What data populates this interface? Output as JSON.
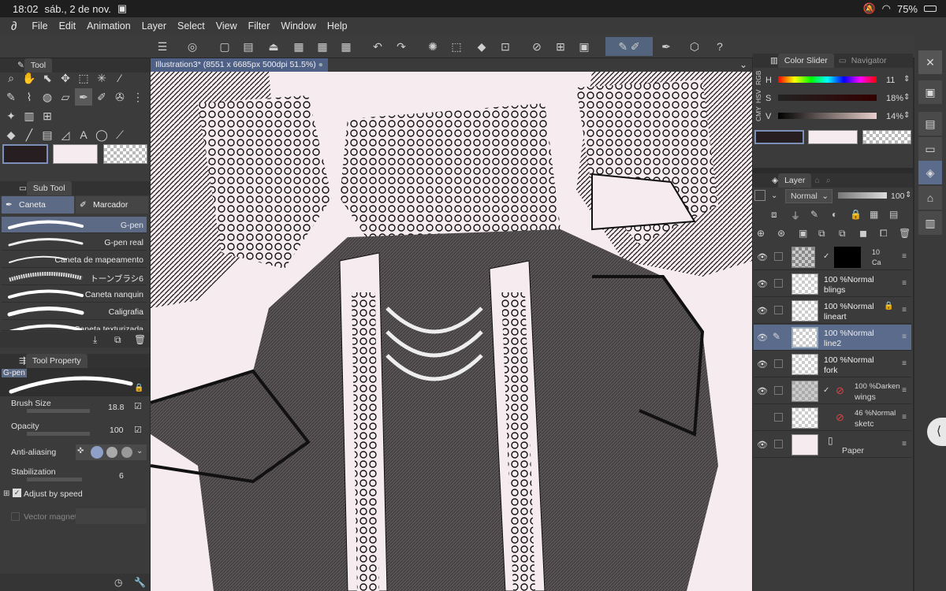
{
  "status_bar": {
    "time": "18:02",
    "date": "sáb., 2 de nov.",
    "battery": "75%"
  },
  "menu": [
    "File",
    "Edit",
    "Animation",
    "Layer",
    "Select",
    "View",
    "Filter",
    "Window",
    "Help"
  ],
  "document_tab": {
    "title": "Illustration3* (8551 x 6685px 500dpi 51.5%)"
  },
  "tool_panel": {
    "title": "Tool"
  },
  "sub_tool_panel": {
    "title": "Sub Tool",
    "tabs": [
      "Caneta",
      "Marcador"
    ],
    "brushes": [
      "G-pen",
      "G-pen real",
      "Caneta de mapeamento",
      "トーンブラシ6",
      "Caneta nanquin",
      "Caligrafia",
      "Caneta texturizada"
    ]
  },
  "tool_property": {
    "title": "Tool Property",
    "preset_name": "G-pen",
    "brush_size_label": "Brush Size",
    "brush_size": "18.8",
    "opacity_label": "Opacity",
    "opacity": "100",
    "anti_aliasing_label": "Anti-aliasing",
    "stabilization_label": "Stabilization",
    "stabilization": "6",
    "adjust_by_speed_label": "Adjust by speed",
    "vector_magnet_label": "Vector magnet"
  },
  "color_slider": {
    "tabs": [
      "Color Slider",
      "Navigator"
    ],
    "side_modes": [
      "RGB",
      "HSV",
      "CMY"
    ],
    "h_label": "H",
    "h_value": "11",
    "s_label": "S",
    "s_value": "18%",
    "v_label": "V",
    "v_value": "14%",
    "main_color": "#261e20",
    "sub_color": "#f6ecef"
  },
  "layer_panel": {
    "title": "Layer",
    "blend_mode": "Normal",
    "opacity": "100",
    "layers": [
      {
        "mode": "10",
        "name": "Ca"
      },
      {
        "mode": "100 %Normal",
        "name": "blings"
      },
      {
        "mode": "100 %Normal",
        "name": "lineart"
      },
      {
        "mode": "100 %Normal",
        "name": "line2"
      },
      {
        "mode": "100 %Normal",
        "name": "fork"
      },
      {
        "mode": "100 %Darken",
        "name": "wings"
      },
      {
        "mode": "46 %Normal",
        "name": "sketc"
      },
      {
        "mode": "",
        "name": "Paper"
      }
    ]
  }
}
